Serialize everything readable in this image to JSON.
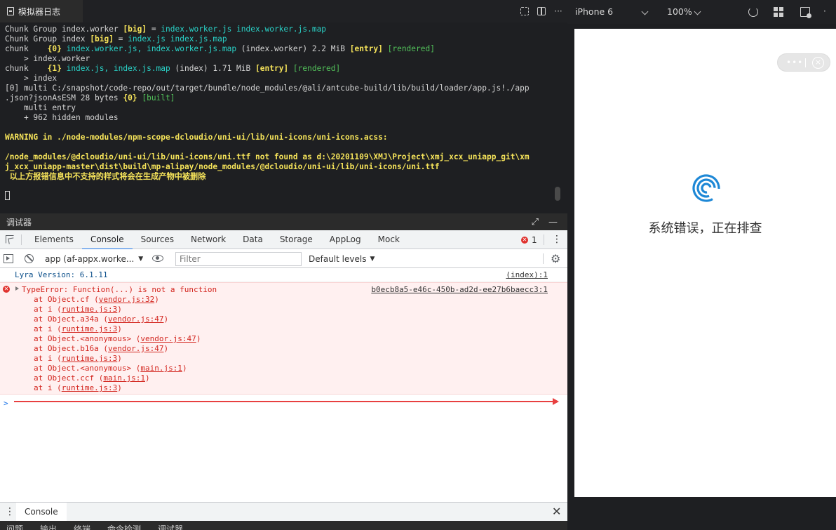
{
  "simulator_log": {
    "tab_title": "模拟器日志",
    "lines": [
      [
        {
          "t": "Chunk Group index.worker ",
          "c": ""
        },
        {
          "t": "[big]",
          "c": "y"
        },
        {
          "t": " = ",
          "c": ""
        },
        {
          "t": "index.worker.js index.worker.js.map",
          "c": "cy"
        }
      ],
      [
        {
          "t": "Chunk Group index ",
          "c": ""
        },
        {
          "t": "[big]",
          "c": "y"
        },
        {
          "t": " = ",
          "c": ""
        },
        {
          "t": "index.js index.js.map",
          "c": "cy"
        }
      ],
      [
        {
          "t": "chunk    ",
          "c": ""
        },
        {
          "t": "{0}",
          "c": "y"
        },
        {
          "t": " index.worker.js, index.worker.js.map",
          "c": "cy"
        },
        {
          "t": " (index.worker) 2.2 MiB ",
          "c": ""
        },
        {
          "t": "[entry]",
          "c": "y"
        },
        {
          "t": " [rendered]",
          "c": "g"
        }
      ],
      [
        {
          "t": "    > index.worker",
          "c": ""
        }
      ],
      [
        {
          "t": "chunk    ",
          "c": ""
        },
        {
          "t": "{1}",
          "c": "y"
        },
        {
          "t": " index.js, index.js.map",
          "c": "cy"
        },
        {
          "t": " (index) 1.71 MiB ",
          "c": ""
        },
        {
          "t": "[entry]",
          "c": "y"
        },
        {
          "t": " [rendered]",
          "c": "g"
        }
      ],
      [
        {
          "t": "    > index",
          "c": ""
        }
      ],
      [
        {
          "t": "[0] multi C:/snapshot/code-repo/out/target/bundle/node_modules/@ali/antcube-build/lib/build/loader/app.js!./app",
          "c": ""
        }
      ],
      [
        {
          "t": ".json?jsonAsESM 28 bytes ",
          "c": ""
        },
        {
          "t": "{0}",
          "c": "y"
        },
        {
          "t": " [built]",
          "c": "g"
        }
      ],
      [
        {
          "t": "    multi entry",
          "c": ""
        }
      ],
      [
        {
          "t": "    + 962 hidden modules",
          "c": ""
        }
      ],
      [
        {
          "t": "",
          "c": ""
        }
      ],
      [
        {
          "t": "WARNING in ./node-modules/npm-scope-dcloudio/uni-ui/lib/uni-icons/uni-icons.acss:",
          "c": "w"
        }
      ],
      [
        {
          "t": "",
          "c": ""
        }
      ],
      [
        {
          "t": "/node_modules/@dcloudio/uni-ui/lib/uni-icons/uni.ttf not found as d:\\20201109\\XMJ\\Project\\xmj_xcx_uniapp_git\\xm",
          "c": "w"
        }
      ],
      [
        {
          "t": "j_xcx_uniapp-master\\dist\\build\\mp-alipay/node_modules/@dcloudio/uni-ui/lib/uni-icons/uni.ttf",
          "c": "w"
        }
      ],
      [
        {
          "t": " 以上方报错信息中不支持的样式将会在生成产物中被删除",
          "c": "w"
        }
      ]
    ]
  },
  "debugger": {
    "title": "调试器",
    "tabs": [
      "Elements",
      "Console",
      "Sources",
      "Network",
      "Data",
      "Storage",
      "AppLog",
      "Mock"
    ],
    "active_tab": "Console",
    "error_count": "1",
    "context": "app (af-appx.worke...",
    "filter_placeholder": "Filter",
    "levels": "Default levels"
  },
  "console": {
    "info_message": "Lyra Version: 6.1.11",
    "info_source": "(index):1",
    "error_message": "TypeError: Function(...) is not a function",
    "error_source": "b0ecb8a5-e46c-450b-ad2d-ee27b6baecc3:1",
    "stack": [
      {
        "fn": "at Object.cf (",
        "link": "vendor.js:32",
        "end": ")"
      },
      {
        "fn": "at i (",
        "link": "runtime.js:3",
        "end": ")"
      },
      {
        "fn": "at Object.a34a (",
        "link": "vendor.js:47",
        "end": ")"
      },
      {
        "fn": "at i (",
        "link": "runtime.js:3",
        "end": ")"
      },
      {
        "fn": "at Object.<anonymous> (",
        "link": "vendor.js:47",
        "end": ")"
      },
      {
        "fn": "at Object.b16a (",
        "link": "vendor.js:47",
        "end": ")"
      },
      {
        "fn": "at i (",
        "link": "runtime.js:3",
        "end": ")"
      },
      {
        "fn": "at Object.<anonymous> (",
        "link": "main.js:1",
        "end": ")"
      },
      {
        "fn": "at Object.ccf (",
        "link": "main.js:1",
        "end": ")"
      },
      {
        "fn": "at i (",
        "link": "runtime.js:3",
        "end": ")"
      }
    ],
    "prompt": ">"
  },
  "drawer": {
    "tab": "Console"
  },
  "bottom_tabs": [
    "问题",
    "输出",
    "终端",
    "命令检测",
    "调试器"
  ],
  "simulator": {
    "device": "iPhone 6",
    "zoom": "100%",
    "error_text": "系统错误，正在排查"
  }
}
